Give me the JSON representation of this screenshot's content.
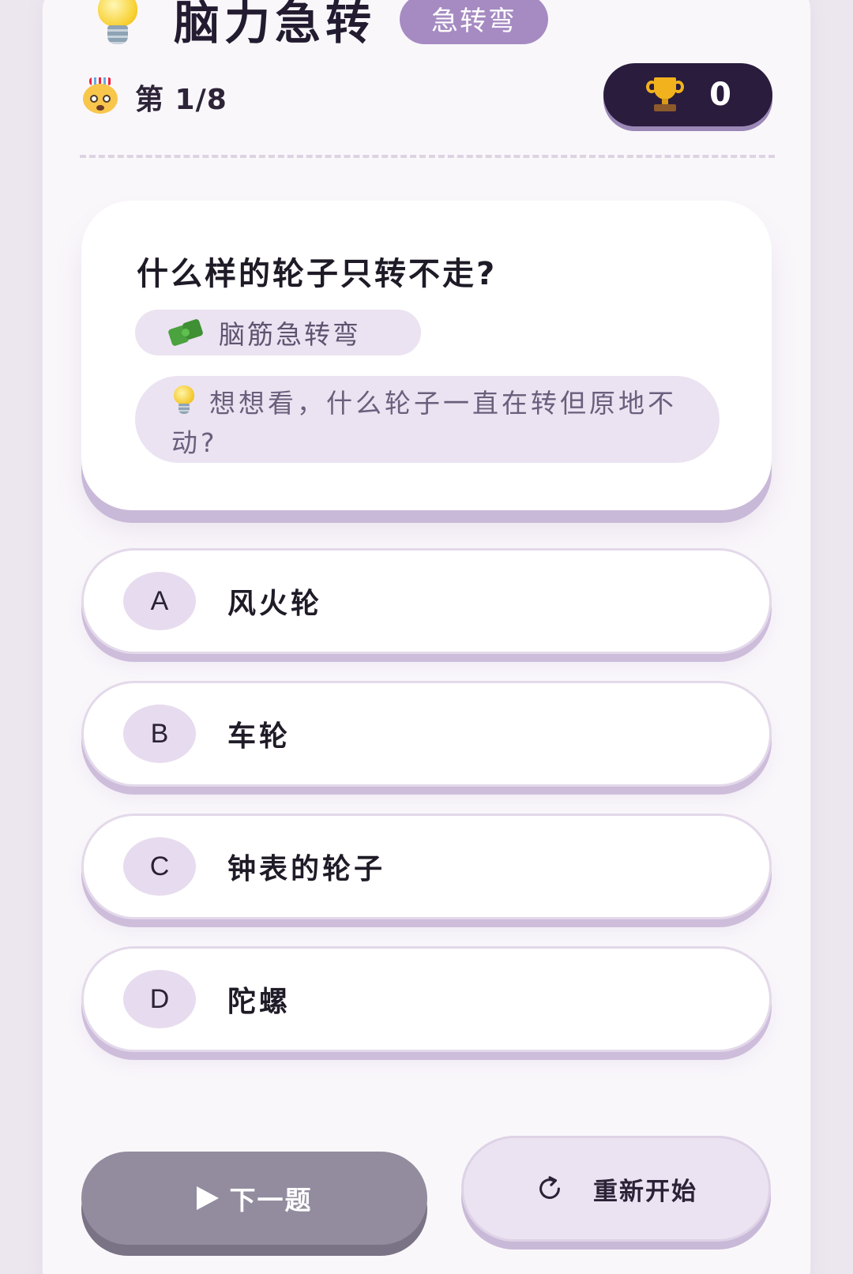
{
  "header": {
    "app_title": "脑力急转",
    "title_badge": "急转弯",
    "progress_text": "第 1/8",
    "score": "0"
  },
  "question_card": {
    "question": "什么样的轮子只转不走?",
    "category": "脑筋急转弯",
    "hint": "想想看，什么轮子一直在转但原地不动?"
  },
  "options": [
    {
      "letter": "A",
      "text": "风火轮"
    },
    {
      "letter": "B",
      "text": "车轮"
    },
    {
      "letter": "C",
      "text": "钟表的轮子"
    },
    {
      "letter": "D",
      "text": "陀螺"
    }
  ],
  "actions": {
    "next_label": "下一题",
    "restart_label": "重新开始"
  },
  "icons": {
    "title": "lightbulb-icon",
    "progress": "exploding-head-icon",
    "score": "trophy-icon",
    "category": "puzzle-icon",
    "hint": "lightbulb-icon",
    "next": "play-icon",
    "restart": "refresh-icon"
  },
  "colors": {
    "accent": "#a58bc2",
    "score_bg": "#2a1c3d",
    "next_button": "#938c9f",
    "tag_bg": "#ebe3f1"
  }
}
